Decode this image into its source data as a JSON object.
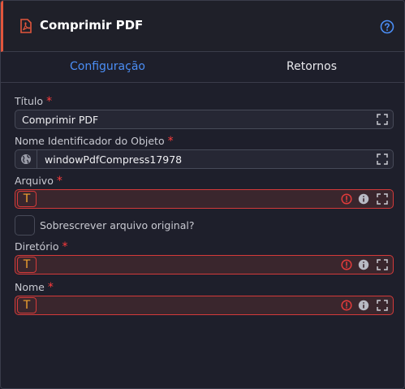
{
  "header": {
    "title": "Comprimir PDF",
    "accent_color": "#e2563c",
    "icons": {
      "pdf": "pdf-file-icon",
      "help": "question-circle-icon"
    }
  },
  "tabs": [
    {
      "label": "Configuração",
      "active": true
    },
    {
      "label": "Retornos",
      "active": false
    }
  ],
  "fields": {
    "titulo": {
      "label": "Título",
      "required": "*",
      "value": "Comprimir PDF"
    },
    "nome_identificador": {
      "label": "Nome Identificador do Objeto",
      "required": "*",
      "value": "windowPdfCompress17978"
    },
    "arquivo": {
      "label": "Arquivo",
      "required": "*",
      "value": "",
      "type_badge": "T",
      "state": "error"
    },
    "sobrescrever": {
      "label": "Sobrescrever arquivo original?",
      "checked": false
    },
    "diretorio": {
      "label": "Diretório",
      "required": "*",
      "value": "",
      "type_badge": "T",
      "state": "error"
    },
    "nome": {
      "label": "Nome",
      "required": "*",
      "value": "",
      "type_badge": "T",
      "state": "error"
    }
  },
  "colors": {
    "active_tab": "#4b8ef5",
    "required": "#ff3b3b",
    "error_border": "#d43a3a",
    "badge_text": "#f0a030"
  }
}
